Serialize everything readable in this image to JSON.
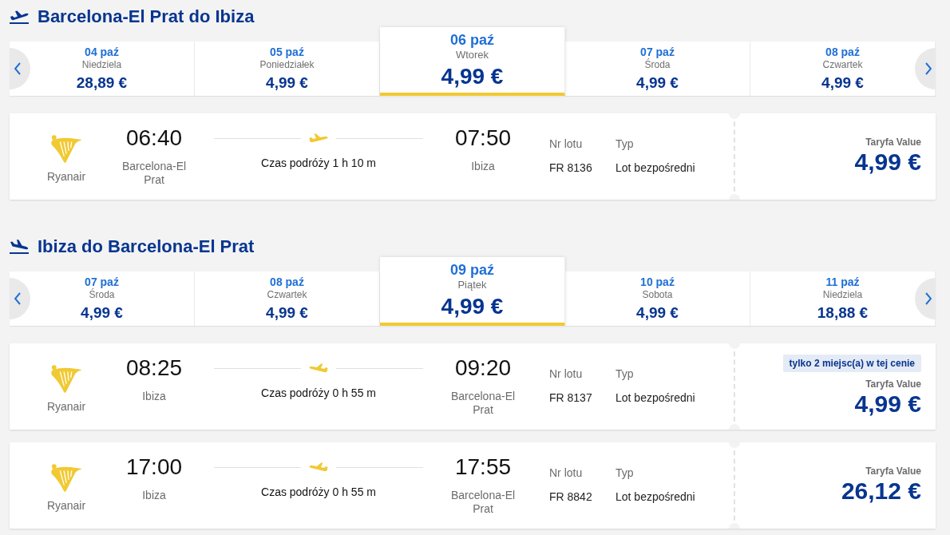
{
  "sections": [
    {
      "kind": "departure",
      "title": "Barcelona-El Prat do Ibiza",
      "dates": [
        {
          "date": "04 paź",
          "day": "Niedziela",
          "price": "28,89 €",
          "selected": false
        },
        {
          "date": "05 paź",
          "day": "Poniedziałek",
          "price": "4,99 €",
          "selected": false
        },
        {
          "date": "06 paź",
          "day": "Wtorek",
          "price": "4,99 €",
          "selected": true
        },
        {
          "date": "07 paź",
          "day": "Środa",
          "price": "4,99 €",
          "selected": false
        },
        {
          "date": "08 paź",
          "day": "Czwartek",
          "price": "4,99 €",
          "selected": false
        }
      ],
      "flights": [
        {
          "airline": "Ryanair",
          "departure_time": "06:40",
          "departure_city": "Barcelona-El Prat",
          "duration": "Czas podróży 1 h 10 m",
          "arrival_time": "07:50",
          "arrival_city": "Ibiza",
          "flight_number_label": "Nr lotu",
          "flight_number": "FR 8136",
          "type_label": "Typ",
          "type": "Lot bezpośredni",
          "fare": "Taryfa Value",
          "price": "4,99 €"
        }
      ]
    },
    {
      "kind": "return",
      "title": "Ibiza do Barcelona-El Prat",
      "dates": [
        {
          "date": "07 paź",
          "day": "Środa",
          "price": "4,99 €",
          "selected": false
        },
        {
          "date": "08 paź",
          "day": "Czwartek",
          "price": "4,99 €",
          "selected": false
        },
        {
          "date": "09 paź",
          "day": "Piątek",
          "price": "4,99 €",
          "selected": true
        },
        {
          "date": "10 paź",
          "day": "Sobota",
          "price": "4,99 €",
          "selected": false
        },
        {
          "date": "11 paź",
          "day": "Niedziela",
          "price": "18,88 €",
          "selected": false
        }
      ],
      "flights": [
        {
          "airline": "Ryanair",
          "departure_time": "08:25",
          "departure_city": "Ibiza",
          "duration": "Czas podróży 0 h 55 m",
          "arrival_time": "09:20",
          "arrival_city": "Barcelona-El Prat",
          "flight_number_label": "Nr lotu",
          "flight_number": "FR 8137",
          "type_label": "Typ",
          "type": "Lot bezpośredni",
          "badge": "tylko 2 miejsc(a) w tej cenie",
          "fare": "Taryfa Value",
          "price": "4,99 €"
        },
        {
          "airline": "Ryanair",
          "departure_time": "17:00",
          "departure_city": "Ibiza",
          "duration": "Czas podróży 0 h 55 m",
          "arrival_time": "17:55",
          "arrival_city": "Barcelona-El Prat",
          "flight_number_label": "Nr lotu",
          "flight_number": "FR 8842",
          "type_label": "Typ",
          "type": "Lot bezpośredni",
          "fare": "Taryfa Value",
          "price": "26,12 €"
        }
      ]
    }
  ]
}
